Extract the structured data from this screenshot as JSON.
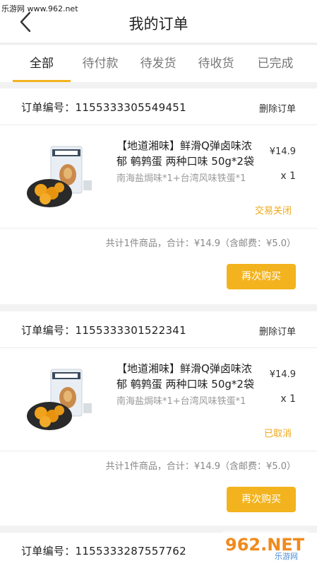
{
  "watermark_top": "乐游网 www.962.net",
  "header": {
    "title": "我的订单"
  },
  "tabs": [
    {
      "label": "全部"
    },
    {
      "label": "待付款"
    },
    {
      "label": "待发货"
    },
    {
      "label": "待收货"
    },
    {
      "label": "已完成"
    }
  ],
  "orders": [
    {
      "order_no": "订单编号：1155333305549451",
      "delete_label": "删除订单",
      "product_name": "【地道湘味】鲜滑Q弹卤味浓郁 鹌鹑蛋 两种口味 50g*2袋",
      "product_spec": "南海盐焗味*1+台湾风味铁蛋*1",
      "price": "¥14.9",
      "qty": "x 1",
      "status": "交易关闭",
      "summary": "共计1件商品，合计：¥14.9（含邮费：¥5.0）",
      "buy_again": "再次购买"
    },
    {
      "order_no": "订单编号：1155333301522341",
      "delete_label": "删除订单",
      "product_name": "【地道湘味】鲜滑Q弹卤味浓郁 鹌鹑蛋 两种口味 50g*2袋",
      "product_spec": "南海盐焗味*1+台湾风味铁蛋*1",
      "price": "¥14.9",
      "qty": "x 1",
      "status": "已取消",
      "summary": "共计1件商品，合计：¥14.9（含邮费：¥5.0）",
      "buy_again": "再次购买"
    },
    {
      "order_no": "订单编号：1155333287557762"
    }
  ],
  "watermark_bottom": {
    "brand": "962.NET",
    "sub": "乐游网"
  },
  "colors": {
    "accent": "#f3b31e",
    "status": "#f0a818"
  }
}
